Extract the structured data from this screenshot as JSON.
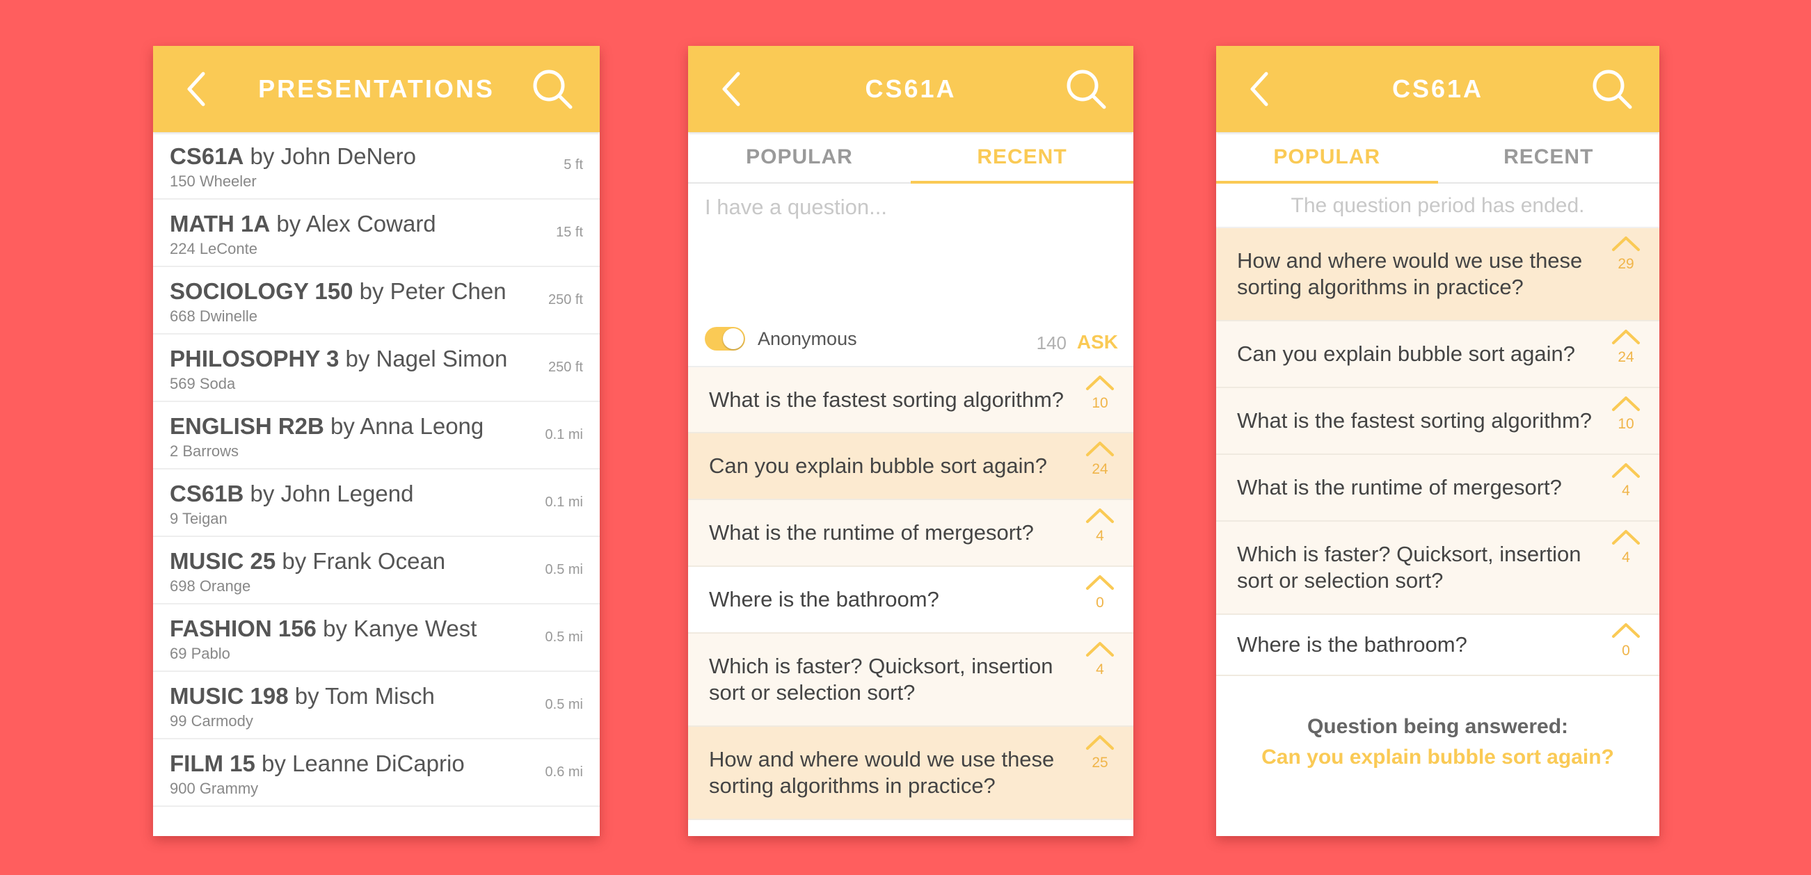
{
  "colors": {
    "background": "#FF5E5E",
    "header": "#FACA55",
    "accent": "#FACA55",
    "row_dark": "#FCEAD0",
    "row_light": "#FDF7EF",
    "row_white": "#FFFFFF"
  },
  "screen1": {
    "title": "PRESENTATIONS",
    "back_icon": "chevron-left-icon",
    "search_icon": "search-icon",
    "items": [
      {
        "course": "CS61A",
        "by": " by John DeNero",
        "location": "150 Wheeler",
        "distance": "5 ft"
      },
      {
        "course": "MATH 1A",
        "by": " by Alex Coward",
        "location": "224 LeConte",
        "distance": "15 ft"
      },
      {
        "course": "SOCIOLOGY 150",
        "by": " by Peter Chen",
        "location": "668 Dwinelle",
        "distance": "250 ft"
      },
      {
        "course": "PHILOSOPHY 3",
        "by": " by Nagel Simon",
        "location": "569 Soda",
        "distance": "250 ft"
      },
      {
        "course": "ENGLISH R2B",
        "by": " by Anna Leong",
        "location": "2 Barrows",
        "distance": "0.1 mi"
      },
      {
        "course": "CS61B",
        "by": " by John Legend",
        "location": "9 Teigan",
        "distance": "0.1 mi"
      },
      {
        "course": "MUSIC 25",
        "by": " by Frank Ocean",
        "location": "698 Orange",
        "distance": "0.5 mi"
      },
      {
        "course": "FASHION 156",
        "by": " by Kanye West",
        "location": "69 Pablo",
        "distance": "0.5 mi"
      },
      {
        "course": "MUSIC 198",
        "by": " by Tom Misch",
        "location": "99 Carmody",
        "distance": "0.5 mi"
      },
      {
        "course": "FILM 15",
        "by": " by Leanne DiCaprio",
        "location": "900 Grammy",
        "distance": "0.6 mi"
      }
    ]
  },
  "screen2": {
    "title": "CS61A",
    "tabs": [
      {
        "label": "POPULAR",
        "active": false
      },
      {
        "label": "RECENT",
        "active": true
      }
    ],
    "ask": {
      "placeholder": "I have a question...",
      "anonymous_label": "Anonymous",
      "anonymous_on": true,
      "char_count": "140",
      "ask_label": "ASK"
    },
    "questions": [
      {
        "text": "What is the fastest sorting algorithm?",
        "votes": "10",
        "shade": "light"
      },
      {
        "text": "Can you explain bubble sort again?",
        "votes": "24",
        "shade": "dark"
      },
      {
        "text": "What is the runtime of mergesort?",
        "votes": "4",
        "shade": "light"
      },
      {
        "text": "Where is the bathroom?",
        "votes": "0",
        "shade": "white"
      },
      {
        "text": "Which is faster?  Quicksort, insertion sort or selection sort?",
        "votes": "4",
        "shade": "light"
      },
      {
        "text": "How and where would we use these sorting algorithms in practice?",
        "votes": "25",
        "shade": "dark"
      }
    ]
  },
  "screen3": {
    "title": "CS61A",
    "tabs": [
      {
        "label": "POPULAR",
        "active": true
      },
      {
        "label": "RECENT",
        "active": false
      }
    ],
    "ended_note": "The question period has ended.",
    "questions": [
      {
        "text": "How and where would we use these sorting algorithms in practice?",
        "votes": "29",
        "shade": "dark"
      },
      {
        "text": "Can you explain bubble sort again?",
        "votes": "24",
        "shade": "light"
      },
      {
        "text": "What is the fastest sorting algorithm?",
        "votes": "10",
        "shade": "light"
      },
      {
        "text": "What is the runtime of mergesort?",
        "votes": "4",
        "shade": "light"
      },
      {
        "text": "Which is faster?  Quicksort, insertion sort or selection sort?",
        "votes": "4",
        "shade": "light"
      },
      {
        "text": "Where is the bathroom?",
        "votes": "0",
        "shade": "white"
      }
    ],
    "answering_label": "Question being answered:",
    "answering_question": "Can you explain bubble sort again?"
  }
}
